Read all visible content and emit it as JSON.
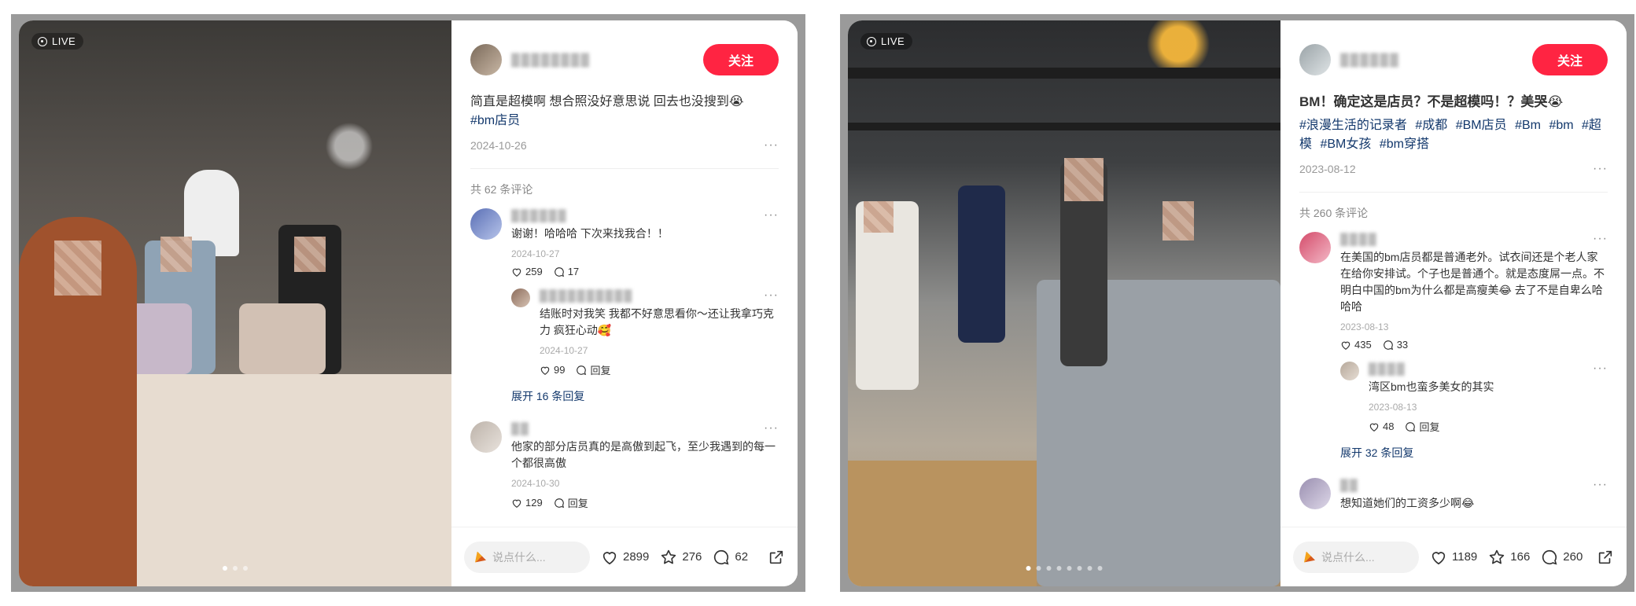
{
  "posts": [
    {
      "live_label": "LIVE",
      "follow_label": "关注",
      "title": "简直是超模啊 想合照没好意思说 回去也没搜到😭",
      "tags": [
        "#bm店员"
      ],
      "date": "2024-10-26",
      "comment_count": "共 62 条评论",
      "comments": [
        {
          "text": "谢谢！哈哈哈 下次来找我合！！",
          "date": "2024-10-27",
          "likes": "259",
          "replies": "17",
          "sub": {
            "text": "结账时对我笑 我都不好意思看你～还让我拿巧克力 疯狂心动🥰",
            "date": "2024-10-27",
            "likes": "99",
            "reply_label": "回复"
          },
          "expand": "展开 16 条回复"
        },
        {
          "text": "他家的部分店员真的是高傲到起飞，至少我遇到的每一个都很高傲",
          "date": "2024-10-30",
          "likes": "129",
          "reply_label": "回复"
        }
      ],
      "input_placeholder": "说点什么...",
      "stats": {
        "likes": "2899",
        "collects": "276",
        "comments": "62"
      },
      "dots_total": 3
    },
    {
      "live_label": "LIVE",
      "follow_label": "关注",
      "title": "BM！确定这是店员？不是超模吗！？美哭😭",
      "tags": [
        "#浪漫生活的记录者",
        "#成都",
        "#BM店员",
        "#Bm",
        "#bm",
        "#超模",
        "#BM女孩",
        "#bm穿搭"
      ],
      "date": "2023-08-12",
      "comment_count": "共 260 条评论",
      "comments": [
        {
          "text": "在美国的bm店员都是普通老外。试衣间还是个老人家在给你安排试。个子也是普通个。就是态度屌一点。不明白中国的bm为什么都是高瘦美😂 去了不是自卑么哈哈哈",
          "date": "2023-08-13",
          "likes": "435",
          "replies": "33",
          "sub": {
            "text": "湾区bm也蛮多美女的其实",
            "date": "2023-08-13",
            "likes": "48",
            "reply_label": "回复"
          },
          "expand": "展开 32 条回复"
        },
        {
          "text": "想知道她们的工资多少啊😂"
        }
      ],
      "input_placeholder": "说点什么...",
      "stats": {
        "likes": "1189",
        "collects": "166",
        "comments": "260"
      },
      "dots_total": 8
    }
  ],
  "colors": {
    "follow": "#ff2442",
    "tag": "#13386c",
    "frame": "#9a9a9a"
  }
}
